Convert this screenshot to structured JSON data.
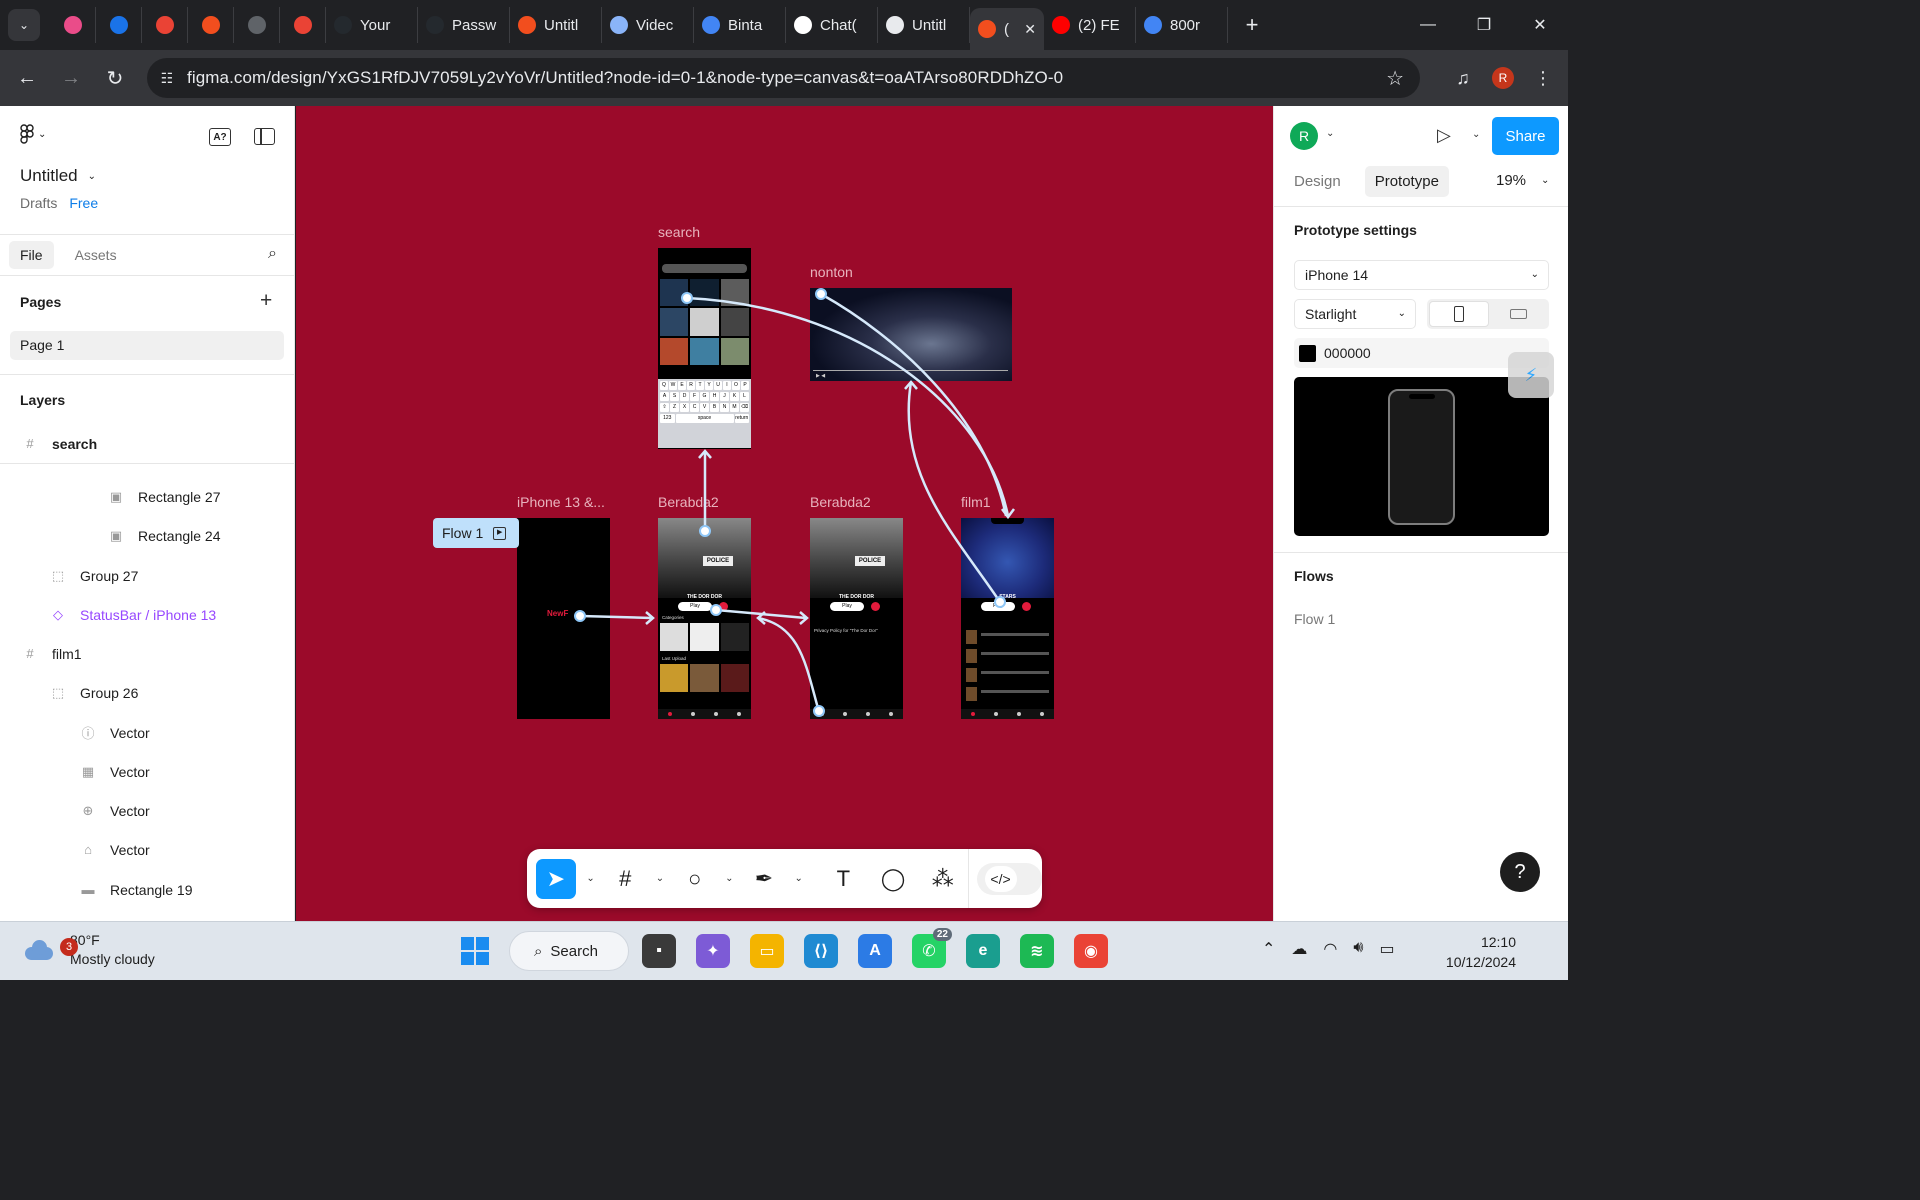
{
  "browser": {
    "tabs": [
      {
        "label": "",
        "icon": "dribbble-icon",
        "color": "#ea4c89"
      },
      {
        "label": "",
        "icon": "play-circle-icon",
        "color": "#1a73e8"
      },
      {
        "label": "",
        "icon": "gmail-icon",
        "color": "#ea4335"
      },
      {
        "label": "",
        "icon": "figma-icon",
        "color": "#f24e1e"
      },
      {
        "label": "",
        "icon": "globe-icon",
        "color": "#5f6368"
      },
      {
        "label": "",
        "icon": "gmail-icon",
        "color": "#ea4335"
      },
      {
        "label": "Your",
        "icon": "github-icon",
        "color": "#24292e"
      },
      {
        "label": "Passw",
        "icon": "github-icon",
        "color": "#24292e"
      },
      {
        "label": "Untitl",
        "icon": "figma-icon",
        "color": "#f24e1e"
      },
      {
        "label": "Videc",
        "icon": "ufo-icon",
        "color": "#8ab4f8"
      },
      {
        "label": "Binta",
        "icon": "google-icon",
        "color": "#4285f4"
      },
      {
        "label": "Chat(",
        "icon": "chatgpt-icon",
        "color": "#ffffff"
      },
      {
        "label": "Untitl",
        "icon": "play-triangle-icon",
        "color": "#e8eaed"
      },
      {
        "label": "(",
        "icon": "figma-icon",
        "color": "#f24e1e"
      },
      {
        "label": "(2) FE",
        "icon": "youtube-icon",
        "color": "#ff0000"
      },
      {
        "label": "800r",
        "icon": "google-icon",
        "color": "#4285f4"
      }
    ],
    "new_tab": "+",
    "url": "figma.com/design/YxGS1RfDJV7059Ly2vYoVr/Untitled?node-id=0-1&node-type=canvas&t=oaATArso80RDDhZO-0",
    "profile_initial": "R"
  },
  "left_panel": {
    "file_name": "Untitled",
    "drafts": "Drafts",
    "plan": "Free",
    "tabs": [
      "File",
      "Assets"
    ],
    "pages_heading": "Pages",
    "page_name": "Page 1",
    "layers_heading": "Layers",
    "layers": [
      {
        "name": "search",
        "icon": "frame-icon"
      },
      {
        "name": "Rectangle 27",
        "icon": "image-icon"
      },
      {
        "name": "Rectangle 24",
        "icon": "image-icon"
      },
      {
        "name": "Group 27",
        "icon": "group-icon"
      },
      {
        "name": "StatusBar / iPhone 13",
        "icon": "component-icon"
      },
      {
        "name": "film1",
        "icon": "frame-icon"
      },
      {
        "name": "Group 26",
        "icon": "group-icon"
      },
      {
        "name": "Vector",
        "icon": "info-icon"
      },
      {
        "name": "Vector",
        "icon": "grid-icon"
      },
      {
        "name": "Vector",
        "icon": "compass-icon"
      },
      {
        "name": "Vector",
        "icon": "home-icon"
      },
      {
        "name": "Rectangle 19",
        "icon": "line-icon"
      }
    ]
  },
  "canvas": {
    "background": "#9b0a2a",
    "flow_tag": "Flow 1",
    "frames": [
      {
        "label": "search"
      },
      {
        "label": "nonton"
      },
      {
        "label": "iPhone 13 &..."
      },
      {
        "label": "Berabda2"
      },
      {
        "label": "Berabda2"
      },
      {
        "label": "film1"
      }
    ],
    "frame_text": {
      "splash_logo": "NewF",
      "police": "POLICE",
      "movie_title": "THE DOR DOR",
      "play": "Play",
      "stars": "STARS",
      "categories": "Categories",
      "last_upload": "Last Upload",
      "privacy_title": "Privacy Policy for \"The Dor Dor\""
    }
  },
  "toolbar": {
    "tools": [
      "move-tool-icon",
      "frame-tool-icon",
      "ellipse-tool-icon",
      "pen-tool-icon",
      "text-tool-icon",
      "comment-tool-icon",
      "actions-tool-icon",
      "dev-mode-icon"
    ]
  },
  "right_panel": {
    "profile_initial": "R",
    "share_label": "Share",
    "tabs": [
      "Design",
      "Prototype"
    ],
    "zoom": "19%",
    "prototype_settings_heading": "Prototype settings",
    "device": "iPhone 14",
    "model_color": "Starlight",
    "background_color": "000000",
    "flows_heading": "Flows",
    "flow_name": "Flow 1"
  },
  "taskbar": {
    "weather_badge": "3",
    "temperature": "80°F",
    "condition": "Mostly cloudy",
    "search_label": "Search",
    "whatsapp_badge": "22",
    "time": "12:10",
    "date": "10/12/2024"
  }
}
